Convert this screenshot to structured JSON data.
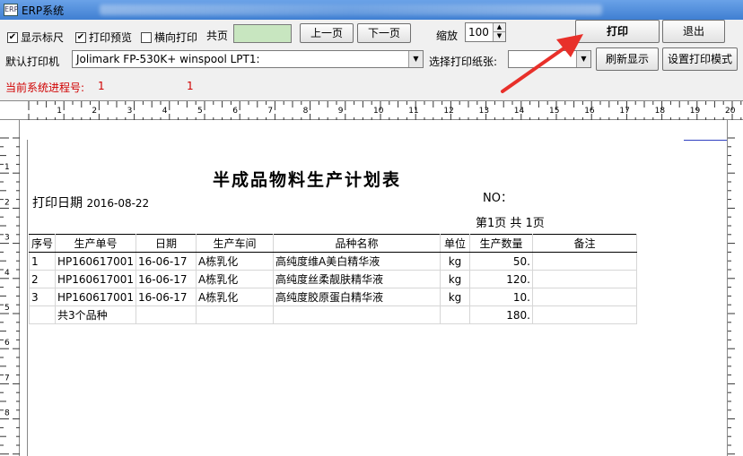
{
  "window": {
    "title": "ERP系统",
    "icon": "erp-app-icon"
  },
  "toolbar": {
    "show_ruler": {
      "label": "显示标尺",
      "checked": true
    },
    "print_preview": {
      "label": "打印预览",
      "checked": true
    },
    "landscape": {
      "label": "横向打印",
      "checked": false
    },
    "total_pages_label": "共页",
    "prev_page": "上一页",
    "next_page": "下一页",
    "zoom_label": "缩放",
    "zoom_value": "100",
    "print_button": "打印",
    "exit_button": "退出",
    "default_printer_label": "默认打印机",
    "printer_value": "Jolimark FP-530K+  winspool  LPT1:",
    "paper_label": "选择打印纸张:",
    "refresh_button": "刷新显示",
    "print_mode_button": "设置打印模式",
    "process_label": "当前系统进程号:",
    "process_value_1": "1",
    "process_value_2": "1"
  },
  "ruler": {
    "h_ticks": [
      "1",
      "2",
      "3",
      "4",
      "5",
      "6",
      "7",
      "8",
      "9",
      "10",
      "11",
      "12",
      "13",
      "14",
      "15",
      "16",
      "17",
      "18",
      "19",
      "20"
    ],
    "v_ticks": [
      "1",
      "2",
      "3",
      "4",
      "5",
      "6",
      "7",
      "8"
    ]
  },
  "document": {
    "title": "半成品物料生产计划表",
    "print_date_label": "打印日期",
    "print_date": "2016-08-22",
    "no_label": "NO：",
    "page_info": "第1页  共 1页",
    "columns": [
      "序号",
      "生产单号",
      "日期",
      "生产车间",
      "品种名称",
      "单位",
      "生产数量",
      "备注"
    ],
    "rows": [
      [
        "1",
        "HP160617001",
        "16-06-17",
        "A栋乳化",
        "高纯度维A美白精华液",
        "kg",
        "50.",
        ""
      ],
      [
        "2",
        "HP160617001",
        "16-06-17",
        "A栋乳化",
        "高纯度丝柔靓肤精华液",
        "kg",
        "120.",
        ""
      ],
      [
        "3",
        "HP160617001",
        "16-06-17",
        "A栋乳化",
        "高纯度胶原蛋白精华液",
        "kg",
        "10.",
        ""
      ]
    ],
    "summary_label": "共3个品种",
    "summary_total": "180."
  },
  "colors": {
    "accent_arrow": "#e8302a",
    "process_text": "#d00000",
    "pages_field": "#c8e6c0"
  }
}
